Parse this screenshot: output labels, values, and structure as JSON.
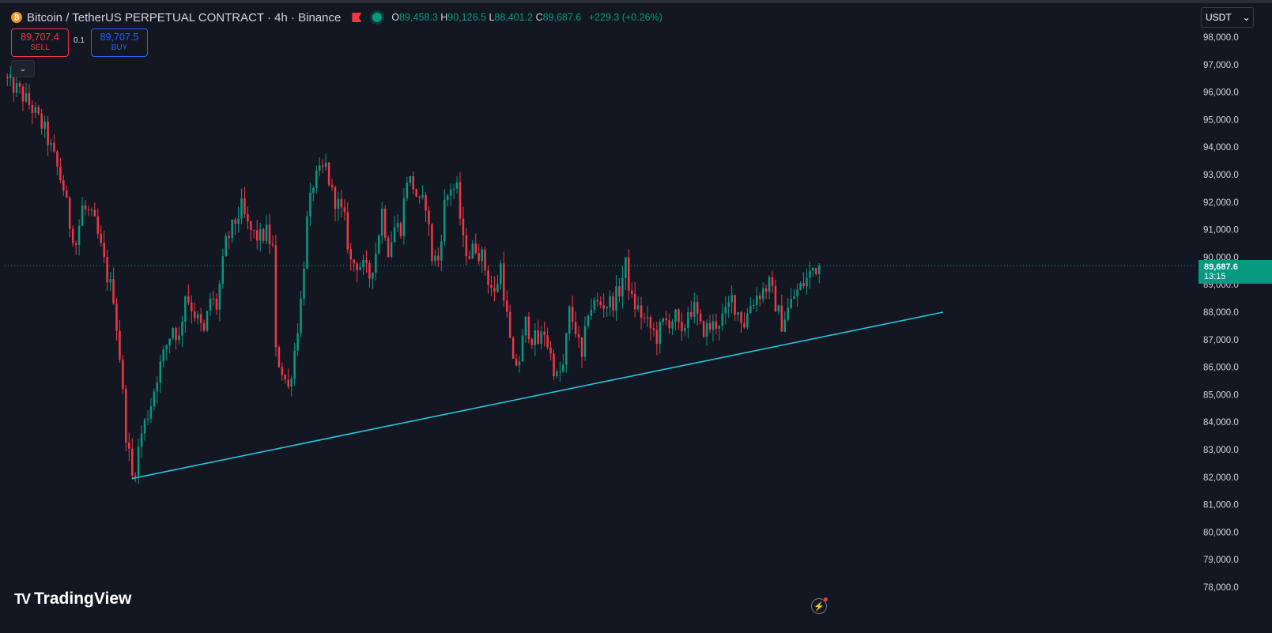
{
  "header": {
    "title": "Bitcoin / TetherUS PERPETUAL CONTRACT · 4h · Binance",
    "coin_icon": "bitcoin-coin-icon",
    "ohlc": {
      "open_label": "O",
      "open": "89,458.3",
      "high_label": "H",
      "high": "90,126.5",
      "low_label": "L",
      "low": "88,401.2",
      "close_label": "C",
      "close": "89,687.6",
      "change": "+229.3 (+0.26%)"
    }
  },
  "trade": {
    "sell_price": "89,707.4",
    "sell_label": "SELL",
    "buy_price": "89,707.5",
    "buy_label": "BUY",
    "quantity": "0.1"
  },
  "currency": {
    "label": "USDT",
    "chevron": "chevron-down-icon"
  },
  "price_tag": {
    "price": "89,687.6",
    "countdown": "13:15"
  },
  "branding": {
    "logo_text": "TradingView",
    "logo_mark": "TV"
  },
  "colors": {
    "background": "#131722",
    "up": "#089981",
    "down": "#f23645",
    "trendline": "#26c6da",
    "axis_text": "#d1d4dc"
  },
  "chart_data": {
    "type": "candlestick",
    "symbol": "BTCUSDT.P",
    "interval": "4h",
    "ylim": [
      77500,
      98500
    ],
    "y_ticks": [
      "98,000.0",
      "97,000.0",
      "96,000.0",
      "95,000.0",
      "94,000.0",
      "93,000.0",
      "92,000.0",
      "91,000.0",
      "90,000.0",
      "89,000.0",
      "88,000.0",
      "87,000.0",
      "86,000.0",
      "85,000.0",
      "84,000.0",
      "83,000.0",
      "82,000.0",
      "81,000.0",
      "80,000.0",
      "79,000.0",
      "78,000.0"
    ],
    "current_price": 89687.6,
    "price_path": [
      [
        0,
        96400
      ],
      [
        4,
        96000
      ],
      [
        8,
        95400
      ],
      [
        12,
        94600
      ],
      [
        15,
        93600
      ],
      [
        18,
        92500
      ],
      [
        20,
        91200
      ],
      [
        22,
        90500
      ],
      [
        24,
        91800
      ],
      [
        26,
        91600
      ],
      [
        28,
        91200
      ],
      [
        30,
        90300
      ],
      [
        32,
        89300
      ],
      [
        34,
        88600
      ],
      [
        36,
        86400
      ],
      [
        38,
        83600
      ],
      [
        40,
        82000
      ],
      [
        41,
        82400
      ],
      [
        43,
        83600
      ],
      [
        46,
        84700
      ],
      [
        48,
        85700
      ],
      [
        51,
        86800
      ],
      [
        53,
        87500
      ],
      [
        55,
        87000
      ],
      [
        57,
        88700
      ],
      [
        59,
        88200
      ],
      [
        61,
        87700
      ],
      [
        63,
        87200
      ],
      [
        65,
        88500
      ],
      [
        67,
        88200
      ],
      [
        70,
        90500
      ],
      [
        73,
        91300
      ],
      [
        75,
        91800
      ],
      [
        77,
        91100
      ],
      [
        79,
        90800
      ],
      [
        81,
        90700
      ],
      [
        83,
        90900
      ],
      [
        85,
        90300
      ],
      [
        86,
        86500
      ],
      [
        88,
        85900
      ],
      [
        90,
        85200
      ],
      [
        92,
        86600
      ],
      [
        94,
        88400
      ],
      [
        96,
        91300
      ],
      [
        98,
        92700
      ],
      [
        100,
        93000
      ],
      [
        102,
        93300
      ],
      [
        104,
        92300
      ],
      [
        106,
        91900
      ],
      [
        108,
        91300
      ],
      [
        110,
        89800
      ],
      [
        112,
        89800
      ],
      [
        114,
        89600
      ],
      [
        116,
        89300
      ],
      [
        118,
        90200
      ],
      [
        120,
        91700
      ],
      [
        122,
        90300
      ],
      [
        124,
        91100
      ],
      [
        126,
        91100
      ],
      [
        128,
        92900
      ],
      [
        130,
        92600
      ],
      [
        132,
        91900
      ],
      [
        134,
        92000
      ],
      [
        136,
        90000
      ],
      [
        138,
        89900
      ],
      [
        140,
        91900
      ],
      [
        142,
        92600
      ],
      [
        144,
        92400
      ],
      [
        146,
        90500
      ],
      [
        148,
        90100
      ],
      [
        150,
        90400
      ],
      [
        152,
        90000
      ],
      [
        154,
        89200
      ],
      [
        156,
        88600
      ],
      [
        158,
        89700
      ],
      [
        160,
        87800
      ],
      [
        162,
        86000
      ],
      [
        164,
        86300
      ],
      [
        166,
        87600
      ],
      [
        168,
        87100
      ],
      [
        170,
        86900
      ],
      [
        172,
        87300
      ],
      [
        174,
        86400
      ],
      [
        176,
        85600
      ],
      [
        178,
        86000
      ],
      [
        180,
        88000
      ],
      [
        182,
        87400
      ],
      [
        184,
        86200
      ],
      [
        186,
        88100
      ],
      [
        188,
        88300
      ],
      [
        190,
        88300
      ],
      [
        192,
        88300
      ],
      [
        194,
        88400
      ],
      [
        196,
        88800
      ],
      [
        198,
        89700
      ],
      [
        200,
        88400
      ],
      [
        202,
        88100
      ],
      [
        204,
        87700
      ],
      [
        206,
        87400
      ],
      [
        208,
        87100
      ],
      [
        210,
        87600
      ],
      [
        212,
        87700
      ],
      [
        214,
        87800
      ],
      [
        216,
        87000
      ],
      [
        218,
        88100
      ],
      [
        220,
        88100
      ],
      [
        222,
        87400
      ],
      [
        224,
        87400
      ],
      [
        226,
        87500
      ],
      [
        228,
        87700
      ],
      [
        230,
        87900
      ],
      [
        232,
        88500
      ],
      [
        234,
        88000
      ],
      [
        236,
        87600
      ],
      [
        238,
        88300
      ],
      [
        240,
        88600
      ],
      [
        242,
        88800
      ],
      [
        244,
        89000
      ],
      [
        246,
        88300
      ],
      [
        248,
        87600
      ],
      [
        250,
        88100
      ],
      [
        252,
        88600
      ],
      [
        254,
        88900
      ],
      [
        256,
        89200
      ],
      [
        258,
        89600
      ],
      [
        260,
        89690
      ]
    ],
    "trendline": [
      [
        40,
        81950
      ],
      [
        300,
        88000
      ]
    ]
  }
}
